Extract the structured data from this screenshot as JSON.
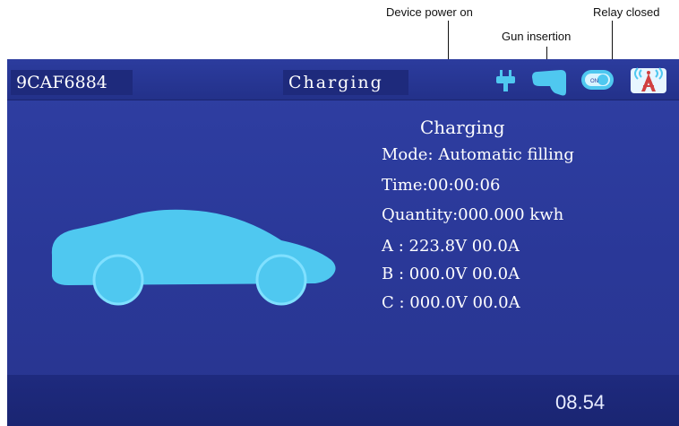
{
  "callouts": {
    "device_power": "Device power on",
    "gun_insertion": "Gun insertion",
    "relay_closed": "Relay closed"
  },
  "header": {
    "device_id": "9CAF6884",
    "status": "Charging"
  },
  "status_icons": [
    "plug-icon",
    "charging-gun-icon",
    "relay-switch-icon",
    "signal-tower-icon"
  ],
  "info": {
    "heading": "Charging",
    "mode": "Mode: Automatic filling",
    "time": "Time:00:00:06",
    "quantity": "Quantity:000.000 kwh",
    "phase_a": "A : 223.8V 00.0A",
    "phase_b": "B : 000.0V 00.0A",
    "phase_c": "C : 000.0V 00.0A"
  },
  "footer": {
    "clock": "08.54"
  },
  "colors": {
    "screen_bg": "#2f3fa3",
    "icon_cyan": "#4fc8f0"
  }
}
